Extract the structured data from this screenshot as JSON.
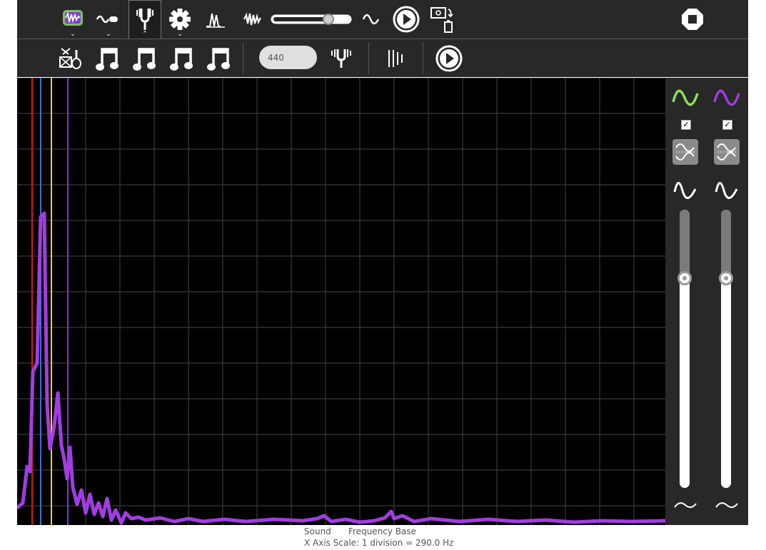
{
  "toolbar": {
    "stop_icon": "stop-icon",
    "play_icon": "play-icon",
    "volume_slider": {
      "value": 0.7
    }
  },
  "controls": {
    "frequency_value": "440"
  },
  "plot": {
    "background": "#000000",
    "grid_color": "#3a3a3a",
    "trace_color": "#a23de0",
    "markers": [
      {
        "color": "#d21c1c"
      },
      {
        "color": "#3a6edc"
      },
      {
        "color": "#ffd400"
      },
      {
        "color": "#8a2be2"
      }
    ]
  },
  "channels": [
    {
      "color": "#8de05a",
      "enabled": true,
      "level": 0.71
    },
    {
      "color": "#a23de0",
      "enabled": true,
      "level": 0.71
    }
  ],
  "footer": {
    "mode": "Sound",
    "base": "Frequency Base",
    "scale": "X Axis Scale: 1 division = 290.0 Hz"
  }
}
